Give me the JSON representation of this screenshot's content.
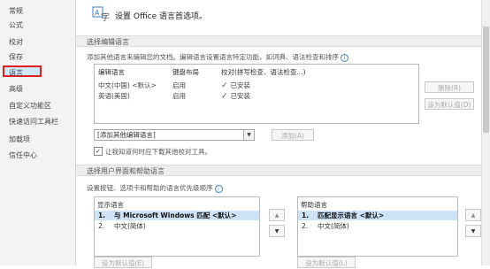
{
  "sidebar": {
    "items": [
      {
        "label": "常规"
      },
      {
        "label": "公式"
      },
      {
        "label": "校对"
      },
      {
        "label": "保存"
      },
      {
        "label": "语言"
      },
      {
        "label": "高级"
      },
      {
        "label": "自定义功能区"
      },
      {
        "label": "快速访问工具栏"
      },
      {
        "label": "加载项"
      },
      {
        "label": "信任中心"
      }
    ],
    "selected_label": "语言"
  },
  "header": {
    "title": "设置 Office 语言首选项。",
    "icon": "language-icon"
  },
  "editing": {
    "section_title": "选择编辑语言",
    "description": "添加其他语言来编辑您的文档。编辑语言设置语言特定功能，如词典、语法检查和排序",
    "table_headers": {
      "lang": "编辑语言",
      "keyboard": "键盘布局",
      "proofing": "校对(拼写检查、语法检查...)"
    },
    "rows": [
      {
        "lang": "中文(中国) <默认>",
        "keyboard": "启用",
        "proofing": "已安装"
      },
      {
        "lang": "英语(美国)",
        "keyboard": "启用",
        "proofing": "已安装"
      }
    ],
    "remove_label": "删除(R)",
    "set_default_label": "设为默认值(D)",
    "add_select_value": "[添加其他编辑语言]",
    "add_label": "添加(A)",
    "checkbox_label": "让我知道何时应下载其他校对工具。",
    "checkbox_checked": true
  },
  "display": {
    "section_title": "选择用户界面和帮助语言",
    "description": "设置按钮、选项卡和帮助的语言优先级顺序",
    "display_list": {
      "header": "显示语言",
      "items": [
        {
          "num": "1.",
          "text": "与 Microsoft Windows 匹配 <默认>"
        },
        {
          "num": "2.",
          "text": "中文(简体)"
        }
      ]
    },
    "help_list": {
      "header": "帮助语言",
      "items": [
        {
          "num": "1.",
          "text": "匹配显示语言 <默认>"
        },
        {
          "num": "2.",
          "text": "中文(简体)"
        }
      ]
    },
    "set_default_label": "设为默认值(E)",
    "set_default_label2": "设为默认值(L)"
  }
}
